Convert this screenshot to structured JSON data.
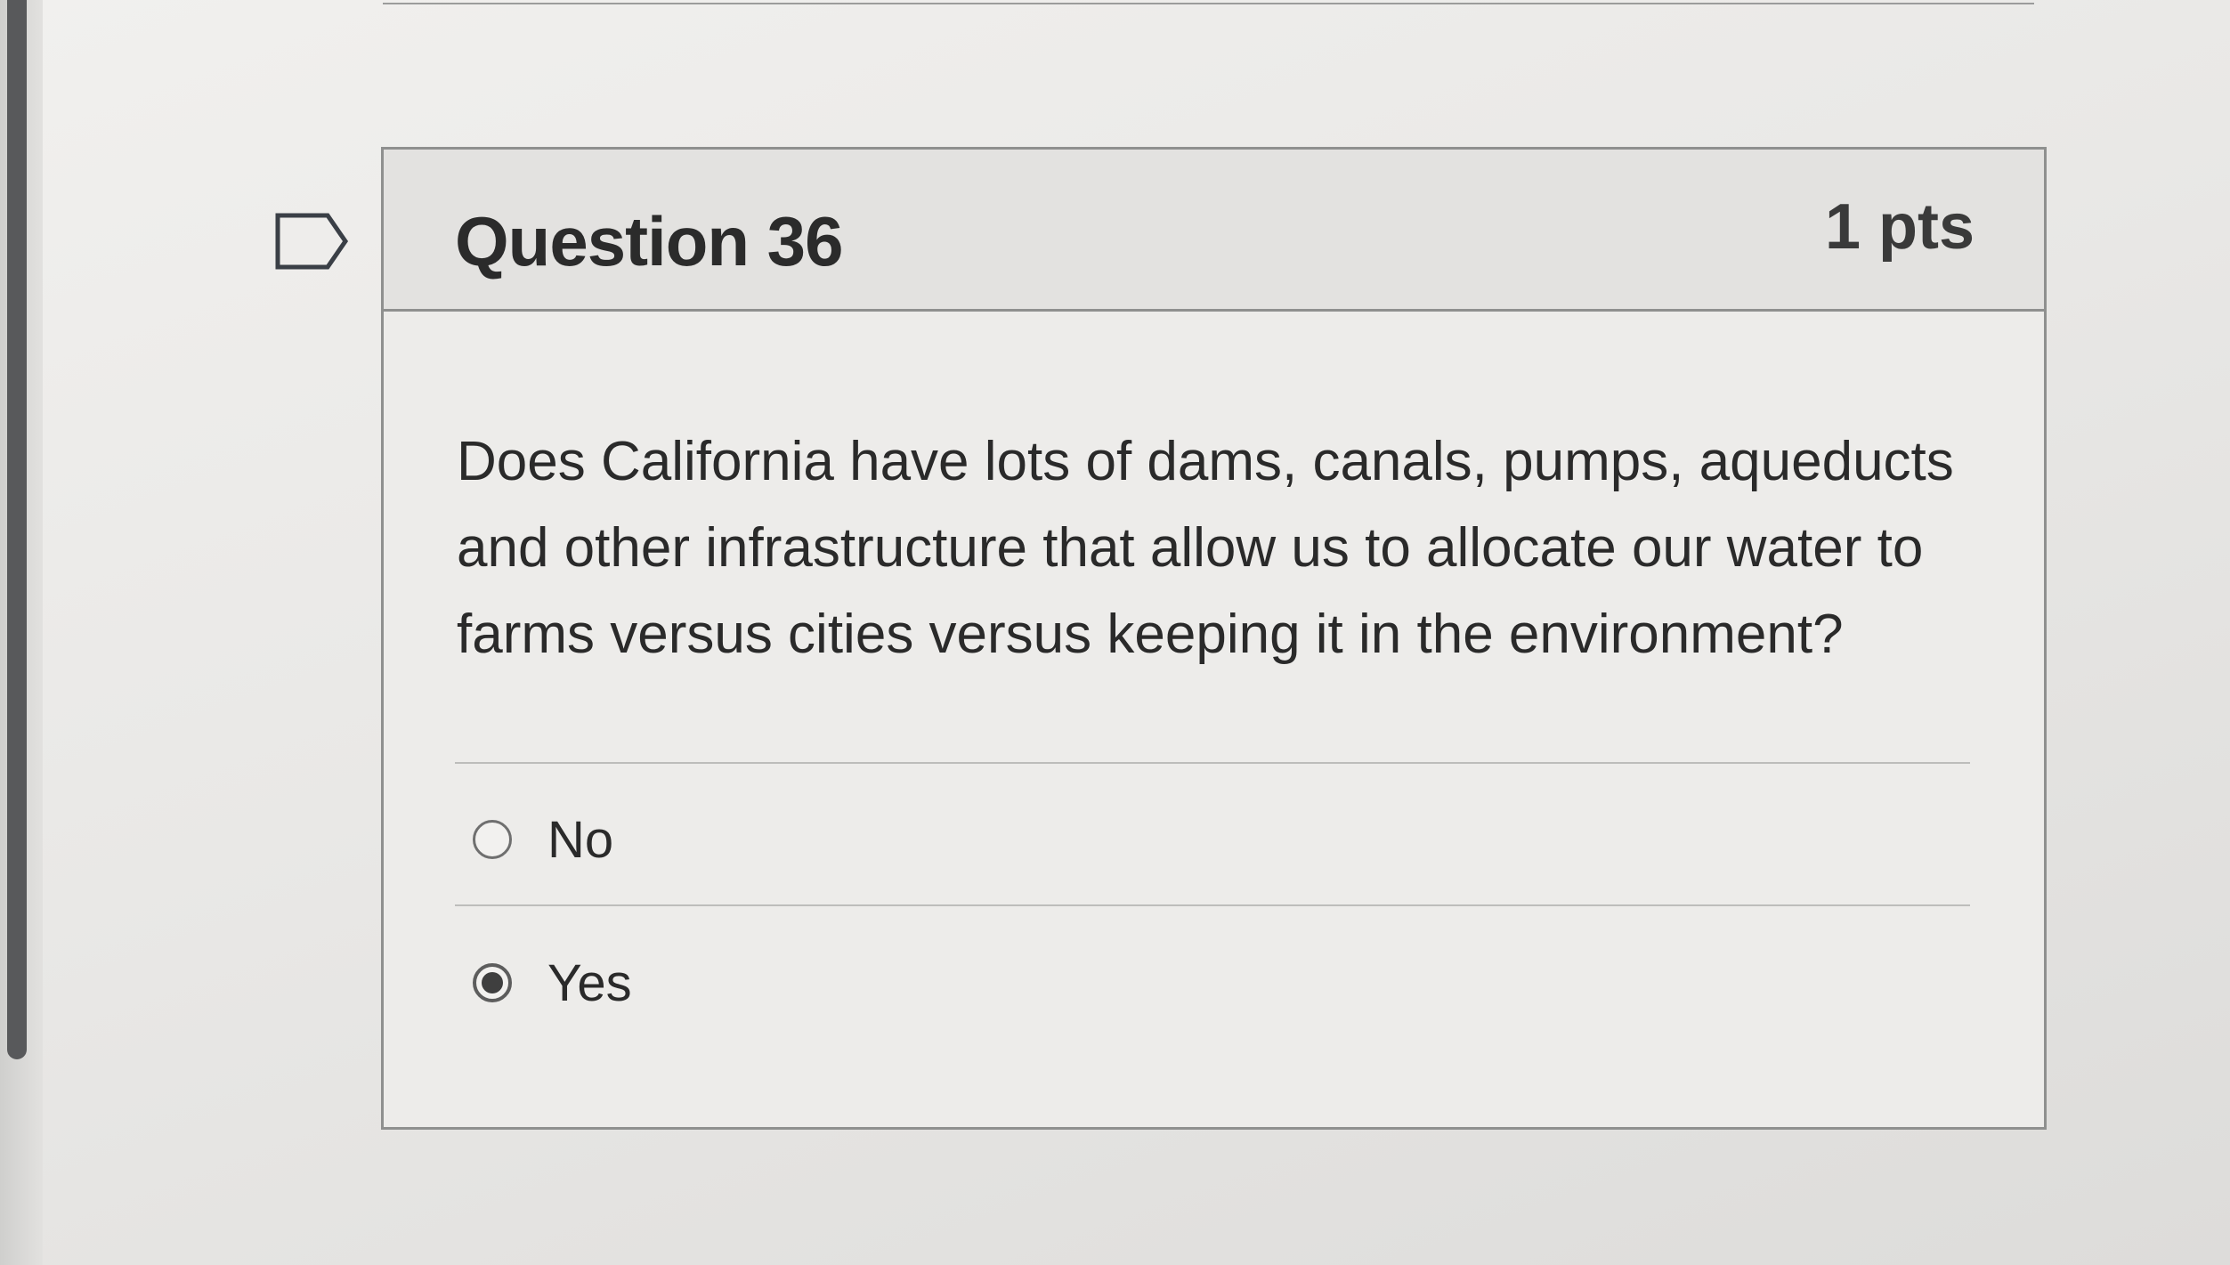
{
  "question": {
    "title": "Question 36",
    "points": "1 pts",
    "text": "Does California have lots of dams, canals, pumps, aqueducts and other infrastructure that allow us to allocate our water to farms versus cities versus keeping it in the environment?",
    "answers": [
      {
        "label": "No",
        "selected": false
      },
      {
        "label": "Yes",
        "selected": true
      }
    ]
  },
  "icons": {
    "flag": "flag-question-icon",
    "radio_empty": "radio-unselected-icon",
    "radio_selected": "radio-selected-icon"
  },
  "colors": {
    "card_border": "#8f908f",
    "header_bg": "#e3e2e0",
    "scrollbar": "#58595b"
  }
}
